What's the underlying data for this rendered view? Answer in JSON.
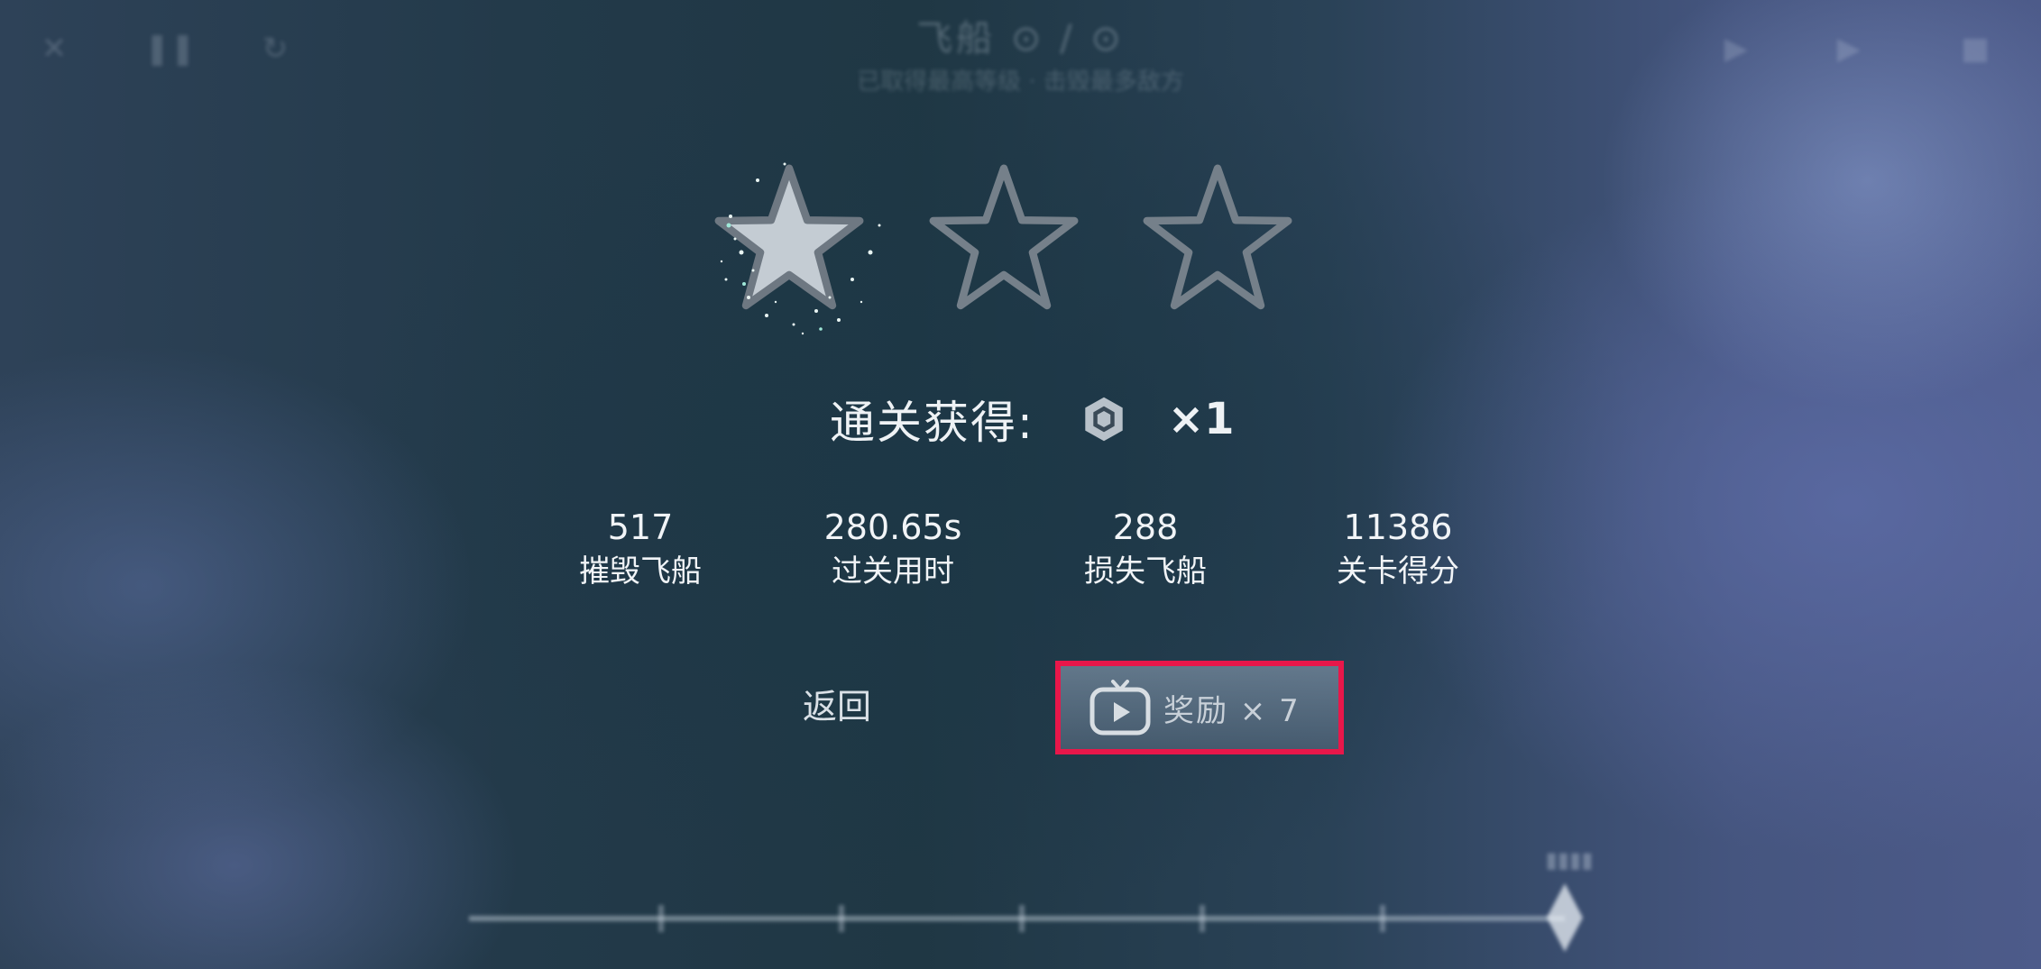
{
  "top_bar": {
    "level_title": "飞船 ⊙ / ⊙",
    "level_subtitle": "已取得最高等级 · 击毁最多敌方"
  },
  "result": {
    "stars_total": 3,
    "stars_earned": 1
  },
  "reward": {
    "label": "通关获得:",
    "icon": "hexagon-gem-icon",
    "count": "×1"
  },
  "stats": [
    {
      "value": "517",
      "label": "摧毁飞船"
    },
    {
      "value": "280.65s",
      "label": "过关用时"
    },
    {
      "value": "288",
      "label": "损失飞船"
    },
    {
      "value": "11386",
      "label": "关卡得分"
    }
  ],
  "buttons": {
    "back_label": "返回",
    "reward_label": "奖励 × 7",
    "reward_icon": "tv-play-icon"
  },
  "colors": {
    "highlight_border": "#e8174a",
    "star_earned_fill": "#c4ccd3",
    "star_outline": "#75808a",
    "text": "#eef2f5"
  }
}
